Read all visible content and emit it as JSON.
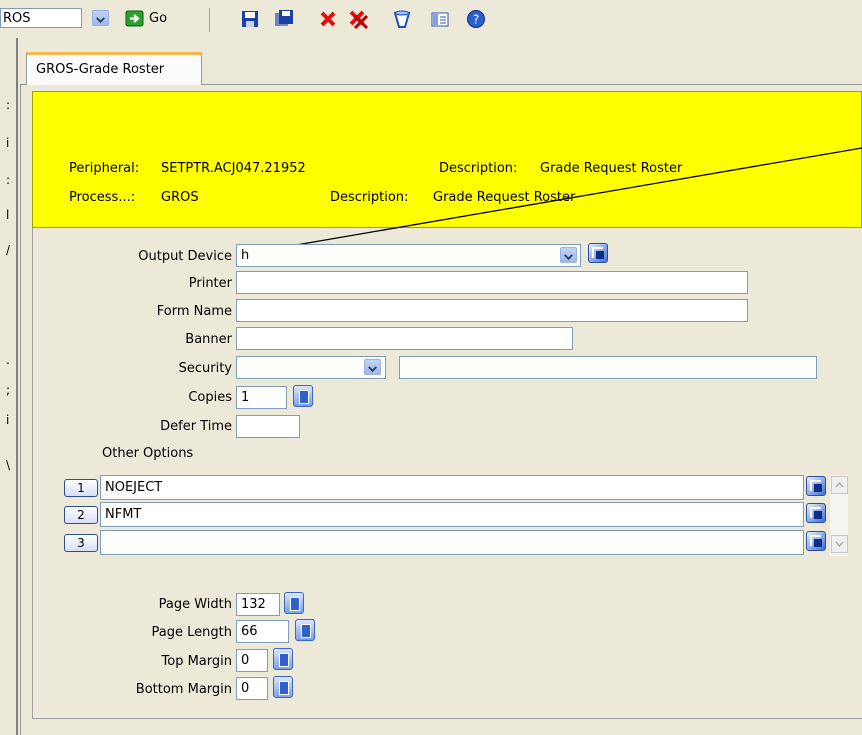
{
  "toolbar": {
    "process_combo_value": "ROS",
    "go_label": "Go",
    "icons": [
      "save-icon",
      "save-copy-icon",
      "delete-icon",
      "delete-all-icon",
      "clear-icon",
      "details-icon",
      "help-icon"
    ]
  },
  "tab": {
    "label": "GROS-Grade Roster"
  },
  "header": {
    "peripheral_label": "Peripheral:",
    "peripheral_value": "SETPTR.ACJ047.21952",
    "peripheral_desc_label": "Description:",
    "peripheral_desc_value": "Grade Request Roster",
    "process_label": "Process...:",
    "process_value": "GROS",
    "process_desc_label": "Description:",
    "process_desc_value": "Grade Request Roster"
  },
  "form": {
    "output_device": {
      "label": "Output Device",
      "value": "h"
    },
    "printer": {
      "label": "Printer",
      "value": ""
    },
    "form_name": {
      "label": "Form Name",
      "value": ""
    },
    "banner": {
      "label": "Banner",
      "value": ""
    },
    "security": {
      "label": "Security",
      "value": "",
      "desc": ""
    },
    "copies": {
      "label": "Copies",
      "value": "1"
    },
    "defer_time": {
      "label": "Defer Time",
      "value": ""
    },
    "other_options": {
      "label": "Other Options",
      "rows": [
        {
          "num": "1",
          "value": "NOEJECT"
        },
        {
          "num": "2",
          "value": "NFMT"
        },
        {
          "num": "3",
          "value": ""
        }
      ]
    },
    "page_width": {
      "label": "Page Width",
      "value": "132"
    },
    "page_length": {
      "label": "Page Length",
      "value": "66"
    },
    "top_margin": {
      "label": "Top Margin",
      "value": "0"
    },
    "bottom_margin": {
      "label": "Bottom Margin",
      "value": "0"
    }
  },
  "colors": {
    "header_bg": "#ffff00",
    "tab_accent": "#f7b64c"
  }
}
